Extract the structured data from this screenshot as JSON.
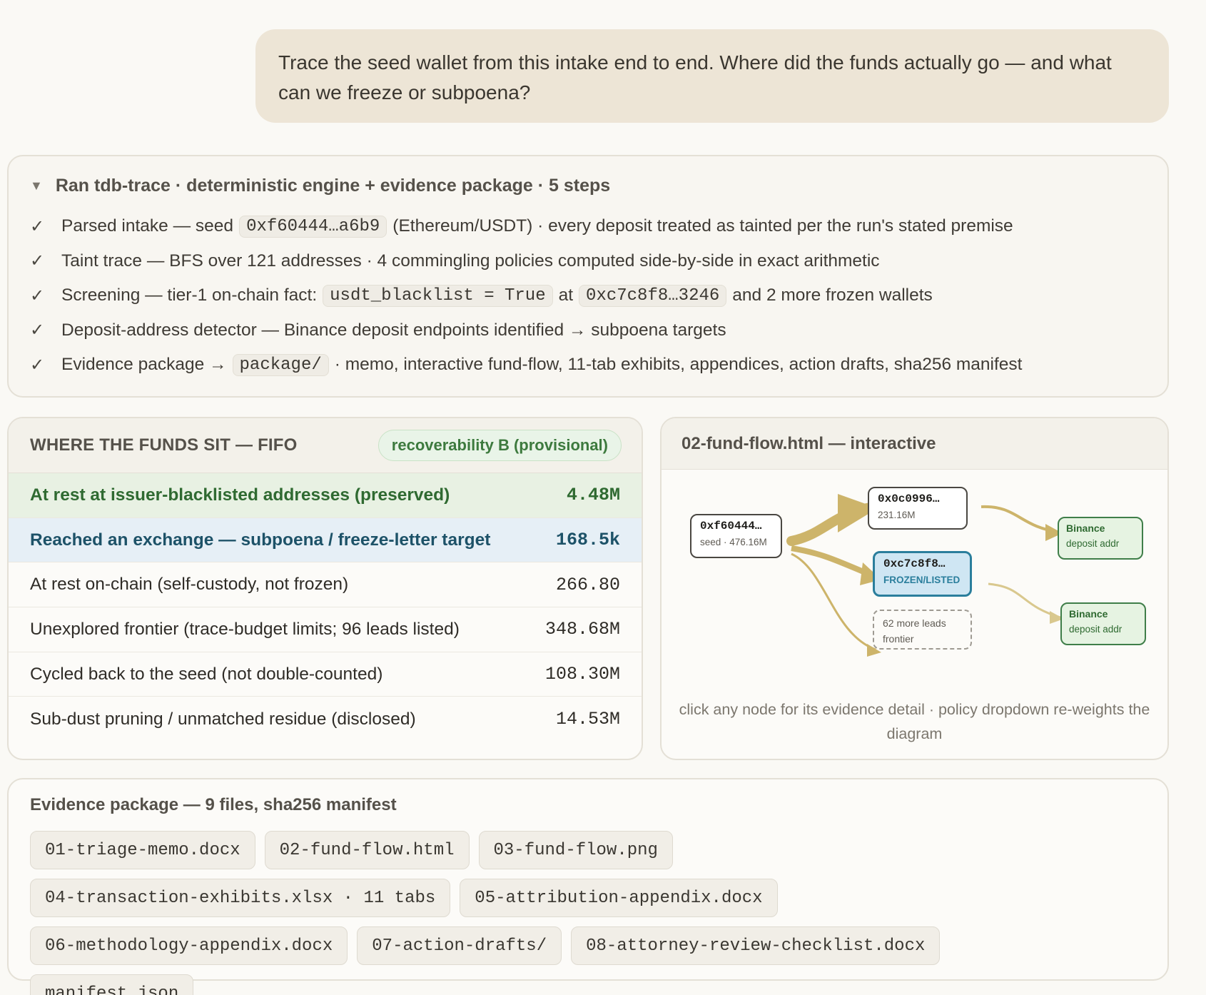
{
  "user_message": "Trace the seed wallet from this intake end to end. Where did the funds actually go — and what can we freeze or subpoena?",
  "run": {
    "title": "Ran tdb-trace · deterministic engine + evidence package · 5 steps",
    "steps": [
      {
        "pre": "Parsed intake — seed",
        "code1": "0xf60444…a6b9",
        "mid": "(Ethereum/USDT) · every deposit treated as tainted per the run's stated premise"
      },
      {
        "pre": "Taint trace — BFS over 121 addresses · 4 commingling policies computed side-by-side in exact arithmetic"
      },
      {
        "pre": "Screening — tier-1 on-chain fact:",
        "code1": "usdt_blacklist = True",
        "mid": "at",
        "code2": "0xc7c8f8…3246",
        "post": "and 2 more frozen wallets"
      },
      {
        "pre": "Deposit-address detector — Binance deposit endpoints identified → subpoena targets"
      },
      {
        "pre": "Evidence package →",
        "code1": "package/",
        "mid": "· memo, interactive fund-flow, 11-tab exhibits, appendices, action drafts, sha256 manifest"
      }
    ]
  },
  "funds": {
    "title": "WHERE THE FUNDS SIT — FIFO",
    "badge": "recoverability B (provisional)",
    "rows": [
      {
        "label": "At rest at issuer-blacklisted addresses (preserved)",
        "value": "4.48M"
      },
      {
        "label": "Reached an exchange — subpoena / freeze-letter target",
        "value": "168.5k"
      },
      {
        "label": "At rest on-chain (self-custody, not frozen)",
        "value": "266.80"
      },
      {
        "label": "Unexplored frontier (trace-budget limits; 96 leads listed)",
        "value": "348.68M"
      },
      {
        "label": "Cycled back to the seed (not double-counted)",
        "value": "108.30M"
      },
      {
        "label": "Sub-dust pruning / unmatched residue (disclosed)",
        "value": "14.53M"
      }
    ]
  },
  "flow": {
    "title": "02-fund-flow.html — interactive",
    "seed": {
      "addr": "0xf60444…",
      "sub": "seed · 476.16M"
    },
    "n1": {
      "addr": "0x0c0996…",
      "sub": "231.16M"
    },
    "frozen": {
      "addr": "0xc7c8f8…",
      "sub": "FROZEN/LISTED"
    },
    "frontier": {
      "line1": "62 more leads",
      "line2": "frontier"
    },
    "binance1": {
      "title": "Binance",
      "sub": "deposit addr"
    },
    "binance2": {
      "title": "Binance",
      "sub": "deposit addr"
    },
    "caption": "click any node for its evidence detail · policy dropdown re-weights the diagram",
    "colors": {
      "edge": "#cdb46a",
      "frozen_border": "#2a7e9c",
      "binance_border": "#3f7e49"
    }
  },
  "package": {
    "title": "Evidence package — 9 files, sha256 manifest",
    "files": [
      "01-triage-memo.docx",
      "02-fund-flow.html",
      "03-fund-flow.png",
      "04-transaction-exhibits.xlsx · 11 tabs",
      "05-attribution-appendix.docx",
      "06-methodology-appendix.docx",
      "07-action-drafts/",
      "08-attorney-review-checklist.docx",
      "manifest.json"
    ]
  }
}
